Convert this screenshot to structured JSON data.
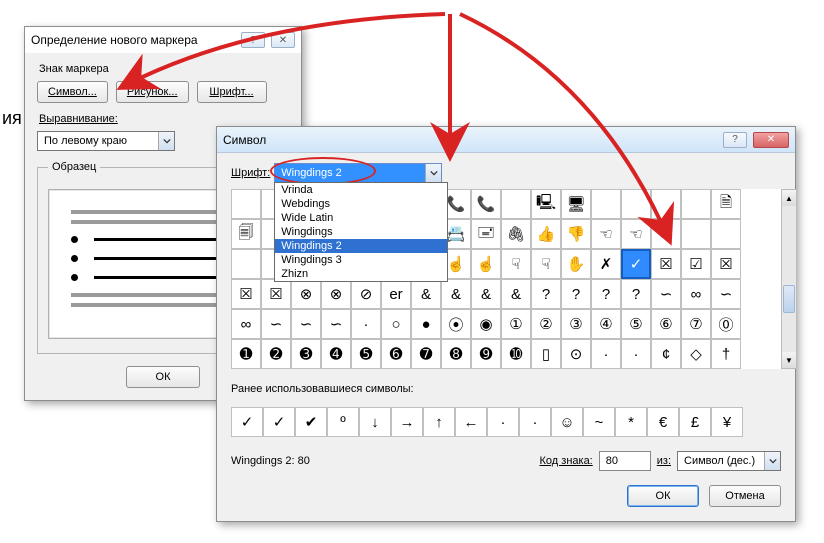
{
  "stray_text": "ия",
  "dlg1": {
    "title": "Определение нового маркера",
    "help": "?",
    "close": "✕",
    "section_marker": "Знак маркера",
    "btn_symbol": "Символ...",
    "btn_image": "Рисунок...",
    "btn_font": "Шрифт...",
    "align_label": "Выравнивание:",
    "align_value": "По левому краю",
    "preview_legend": "Образец",
    "ok": "ОК"
  },
  "dlg2": {
    "title": "Символ",
    "help": "?",
    "close": "✕",
    "font_label": "Шрифт:",
    "font_value": "Wingdings 2",
    "dropdown": [
      "Vrinda",
      "Webdings",
      "Wide Latin",
      "Wingdings",
      "Wingdings 2",
      "Wingdings 3",
      "Zhizn"
    ],
    "dropdown_selected_index": 4,
    "grid": [
      [
        " ",
        " ",
        " ",
        " ",
        " ",
        " ",
        " ",
        "📞",
        "📞",
        " ",
        "🖳",
        "🖥",
        " ",
        " ",
        " ",
        " ",
        "🗎"
      ],
      [
        "🗐",
        " ",
        " ",
        " ",
        " ",
        " ",
        " ",
        "📇",
        "🖃",
        "🖇",
        "👍",
        "👎",
        "☜",
        "☜",
        "☞",
        " ",
        " "
      ],
      [
        " ",
        " ",
        " ",
        " ",
        " ",
        " ",
        " ",
        "☝",
        "☝",
        "☟",
        "☟",
        "✋",
        "✗",
        "✓",
        "☒",
        "☑",
        "☒"
      ],
      [
        "☒",
        "☒",
        "⊗",
        "⊗",
        "⊘",
        "er",
        "&",
        "&",
        "&",
        "&",
        "?",
        "?",
        "?",
        "?",
        "∽",
        "∞",
        "∽"
      ],
      [
        "∞",
        "∽",
        "∽",
        "∽",
        "·",
        "○",
        "●",
        "⦿",
        "◉",
        "①",
        "②",
        "③",
        "④",
        "⑤",
        "⑥",
        "⑦",
        "⓪"
      ],
      [
        "➊",
        "➋",
        "➌",
        "➍",
        "➎",
        "➏",
        "➐",
        "➑",
        "➒",
        "➓",
        "▯",
        "⊙",
        "·",
        "·",
        "¢",
        "◇",
        "†"
      ]
    ],
    "selected": {
      "row": 2,
      "col": 13
    },
    "recent_label": "Ранее использовавшиеся символы:",
    "recent": [
      "✓",
      "✓",
      "✔",
      "º",
      "↓",
      "→",
      "↑",
      "←",
      "·",
      "·",
      "☺",
      "~",
      "*",
      "€",
      "£",
      "¥"
    ],
    "status_left": "Wingdings 2: 80",
    "code_label": "Код знака:",
    "code_value": "80",
    "from_label": "из:",
    "from_value": "Символ (дес.)",
    "ok": "ОК",
    "cancel": "Отмена"
  }
}
